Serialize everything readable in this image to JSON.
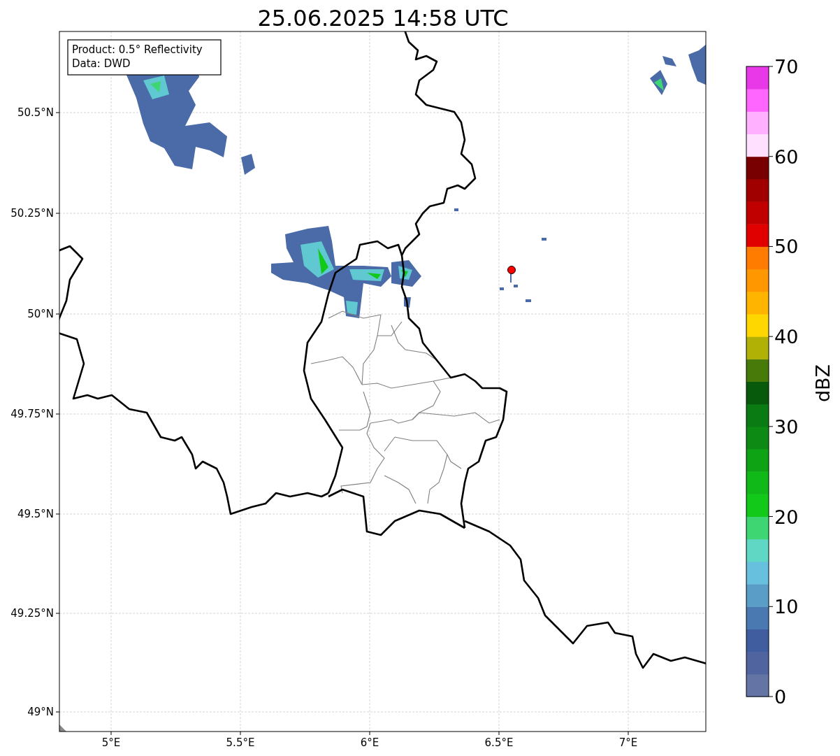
{
  "title": "25.06.2025 14:58 UTC",
  "legend": [
    "Product: 0.5° Reflectivity",
    "Data: DWD"
  ],
  "map": {
    "lat_ticks": [
      "50.5°N",
      "50.25°N",
      "50°N",
      "49.75°N",
      "49.5°N",
      "49.25°N",
      "49°N"
    ],
    "lon_ticks": [
      "5°E",
      "5.5°E",
      "6°E",
      "6.5°E",
      "7°E"
    ]
  },
  "colorbar": {
    "label": "dBZ",
    "ticks": [
      "70",
      "60",
      "50",
      "40",
      "30",
      "20",
      "10",
      "0"
    ],
    "bins": [
      {
        "color": "#6474a4"
      },
      {
        "color": "#5065a0"
      },
      {
        "color": "#405da0"
      },
      {
        "color": "#4a78b0"
      },
      {
        "color": "#5a9ec8"
      },
      {
        "color": "#67c0de"
      },
      {
        "color": "#60d6c4"
      },
      {
        "color": "#3ed672"
      },
      {
        "color": "#12c818"
      },
      {
        "color": "#10b818"
      },
      {
        "color": "#0ea314"
      },
      {
        "color": "#0c8a14"
      },
      {
        "color": "#0a7a12"
      },
      {
        "color": "#075a0c"
      },
      {
        "color": "#487a0a"
      },
      {
        "color": "#b0b005"
      },
      {
        "color": "#ffd700"
      },
      {
        "color": "#ffb400"
      },
      {
        "color": "#ff9800"
      },
      {
        "color": "#ff7c00"
      },
      {
        "color": "#e00000"
      },
      {
        "color": "#c00000"
      },
      {
        "color": "#a00000"
      },
      {
        "color": "#780000"
      },
      {
        "color": "#ffe0ff"
      },
      {
        "color": "#ffb0ff"
      },
      {
        "color": "#ff66ff"
      },
      {
        "color": "#e838e8"
      }
    ]
  }
}
